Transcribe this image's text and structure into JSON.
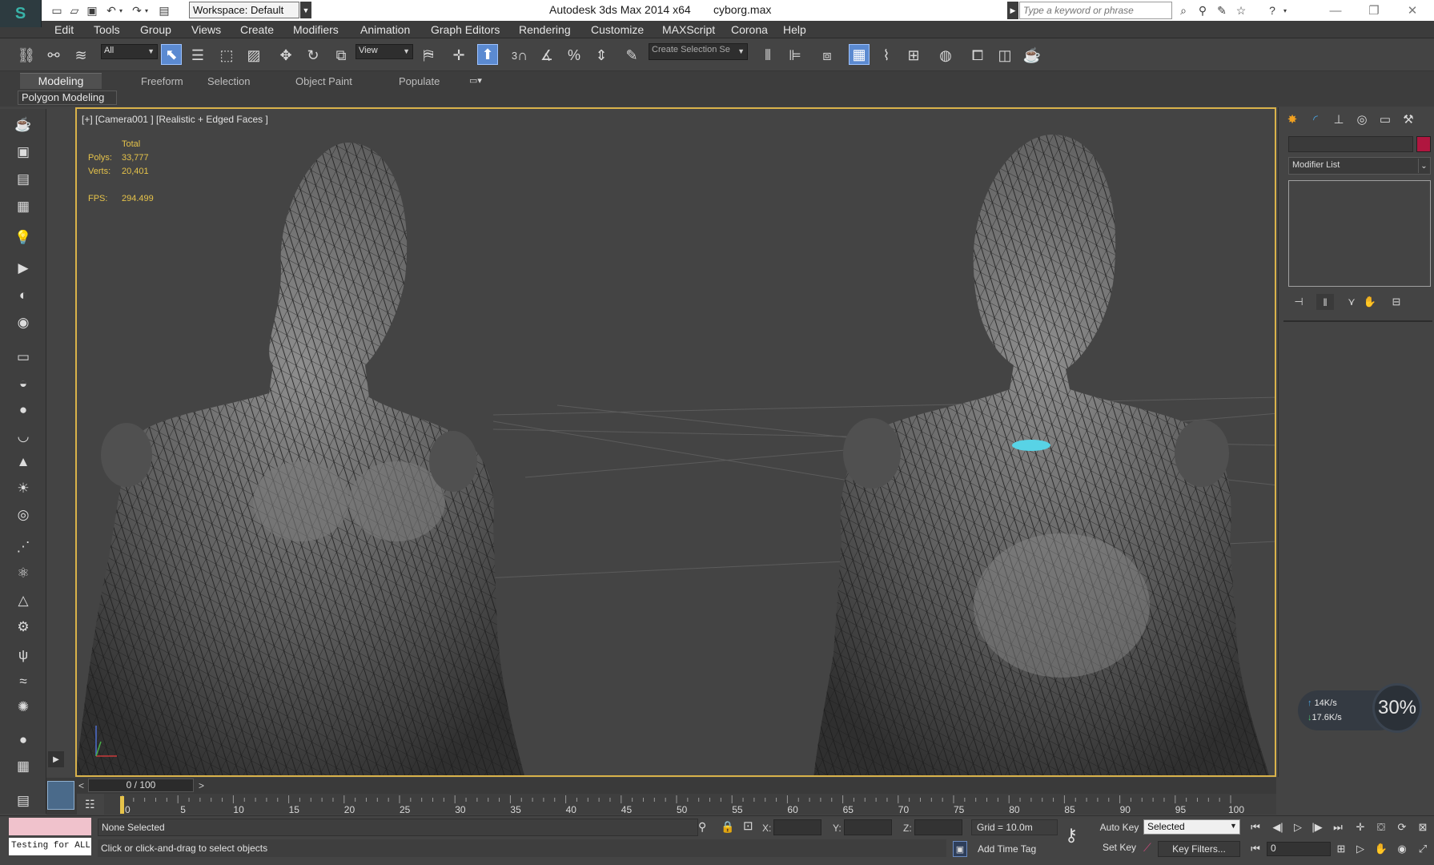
{
  "title_bar": {
    "app_title": "Autodesk 3ds Max  2014 x64",
    "file_name": "cyborg.max",
    "workspace": "Workspace: Default",
    "search_placeholder": "Type a keyword or phrase"
  },
  "menu": [
    "Edit",
    "Tools",
    "Group",
    "Views",
    "Create",
    "Modifiers",
    "Animation",
    "Graph Editors",
    "Rendering",
    "Customize",
    "MAXScript",
    "Corona",
    "Help"
  ],
  "main_toolbar": {
    "selection_filter": "All",
    "reference_coord": "View",
    "named_selection_placeholder": "Create Selection Se",
    "snap_label": "3"
  },
  "ribbon": {
    "tabs": [
      "Modeling",
      "Freeform",
      "Selection",
      "Object Paint",
      "Populate"
    ],
    "panel_label": "Polygon Modeling"
  },
  "viewport": {
    "label": "[+] [Camera001 ] [Realistic + Edged Faces ]",
    "stats": {
      "header": "Total",
      "polys_label": "Polys:",
      "polys_value": "33,777",
      "verts_label": "Verts:",
      "verts_value": "20,401",
      "fps_label": "FPS:",
      "fps_value": "294.499"
    }
  },
  "command_panel": {
    "modifier_list": "Modifier List",
    "object_color": "#b0163f"
  },
  "network_widget": {
    "upload": "14K/s",
    "download": "17.6K/s",
    "percent": "30%"
  },
  "timeline": {
    "slider_label": "0 / 100",
    "slider_prev": "<",
    "slider_next": ">",
    "ticks": [
      "0",
      "5",
      "10",
      "15",
      "20",
      "25",
      "30",
      "35",
      "40",
      "45",
      "50",
      "55",
      "60",
      "65",
      "70",
      "75",
      "80",
      "85",
      "90",
      "95",
      "100"
    ]
  },
  "status_bar": {
    "maxscript_text": "Testing for ALL",
    "selection_status": "None Selected",
    "prompt": "Click or click-and-drag to select objects",
    "x_label": "X:",
    "y_label": "Y:",
    "z_label": "Z:",
    "grid": "Grid = 10.0m",
    "add_time_tag": "Add Time Tag",
    "auto_key": "Auto Key",
    "set_key": "Set Key",
    "selected_dropdown": "Selected",
    "key_filters": "Key Filters...",
    "current_frame": "0"
  },
  "colors": {
    "viewport_border": "#d9b24a",
    "stat_text": "#e6c34a",
    "active_tool": "#5b8ad1"
  }
}
